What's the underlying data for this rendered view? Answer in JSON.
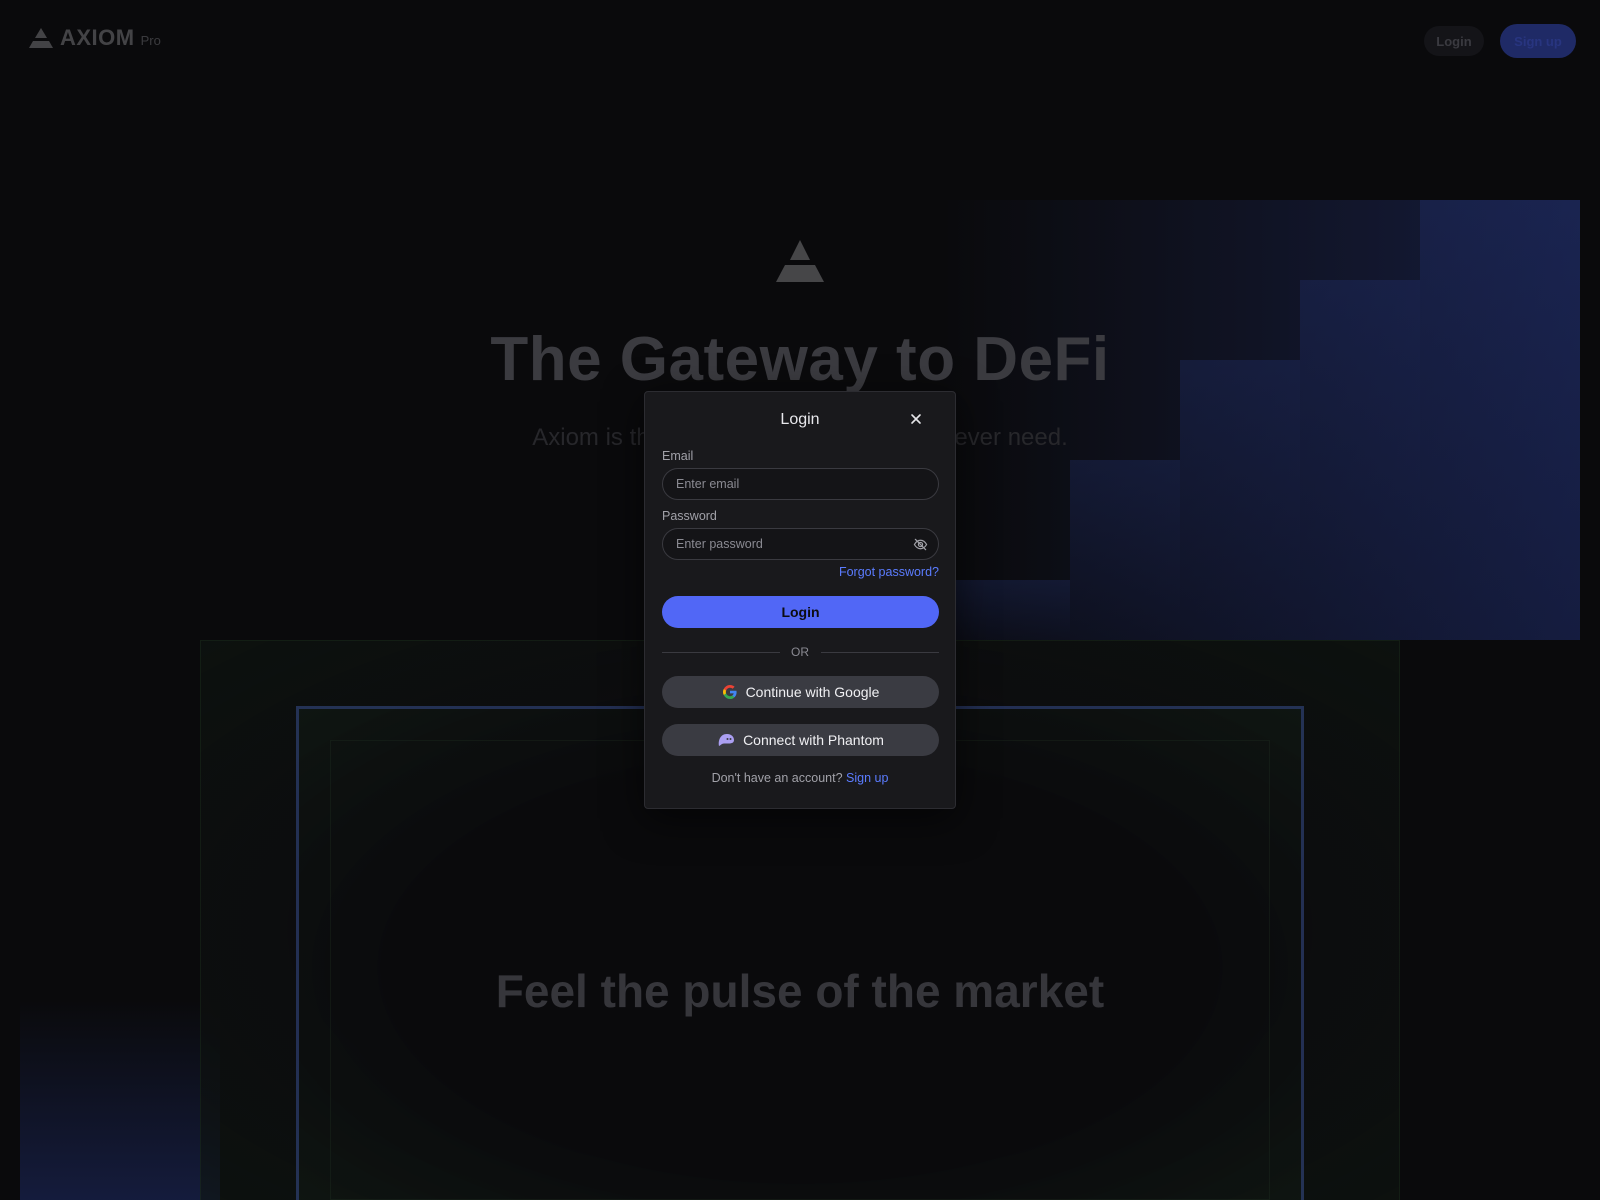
{
  "nav": {
    "brand_name": "AXIOM",
    "brand_sub": "Pro",
    "login_label": "Login",
    "signup_label": "Sign up"
  },
  "hero": {
    "title": "The Gateway to DeFi",
    "subtitle": "Axiom is the only trading platform you'll ever need.",
    "market_title": "Feel the pulse of the market"
  },
  "modal": {
    "title": "Login",
    "close_icon": "close-icon",
    "email": {
      "label": "Email",
      "placeholder": "Enter email",
      "value": ""
    },
    "password": {
      "label": "Password",
      "placeholder": "Enter password",
      "value": "",
      "toggle_icon": "eye-off-icon"
    },
    "forgot_label": "Forgot password?",
    "login_button_label": "Login",
    "divider_label": "OR",
    "google_button_label": "Continue with Google",
    "phantom_button_label": "Connect with Phantom",
    "no_account_text": "Don't have an account?",
    "signup_link_label": "Sign up"
  },
  "colors": {
    "accent": "#5167f6",
    "link": "#5b7cff",
    "modal_bg": "#19191c",
    "page_bg": "#0a0a0c",
    "social_button_bg": "#3a3b42"
  }
}
